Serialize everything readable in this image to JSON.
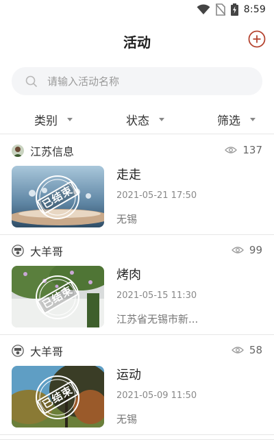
{
  "status_bar": {
    "time": "8:59",
    "icons": [
      "wifi-icon",
      "no-sim-icon",
      "battery-charging-icon"
    ]
  },
  "header": {
    "title": "活动",
    "add_icon": "add-circle-icon"
  },
  "search": {
    "placeholder": "请输入活动名称",
    "value": "",
    "icon": "search-icon"
  },
  "filters": [
    {
      "label": "类别",
      "icon": "caret-down-icon"
    },
    {
      "label": "状态",
      "icon": "caret-down-icon"
    },
    {
      "label": "筛选",
      "icon": "caret-down-icon"
    }
  ],
  "activities": [
    {
      "author": "江苏信息",
      "views": "137",
      "stamp": "已结束",
      "title": "走走",
      "datetime": "2021-05-21 17:50",
      "location": "无锡"
    },
    {
      "author": "大羊哥",
      "views": "99",
      "stamp": "已结束",
      "title": "烤肉",
      "datetime": "2021-05-15 11:30",
      "location": "江苏省无锡市新..."
    },
    {
      "author": "大羊哥",
      "views": "58",
      "stamp": "已结束",
      "title": "运动",
      "datetime": "2021-05-09 11:50",
      "location": "无锡"
    }
  ],
  "colors": {
    "accent": "#b5432f",
    "search_bg": "#f4f5f7",
    "divider": "#e6e6e6",
    "muted_text": "#888888"
  }
}
